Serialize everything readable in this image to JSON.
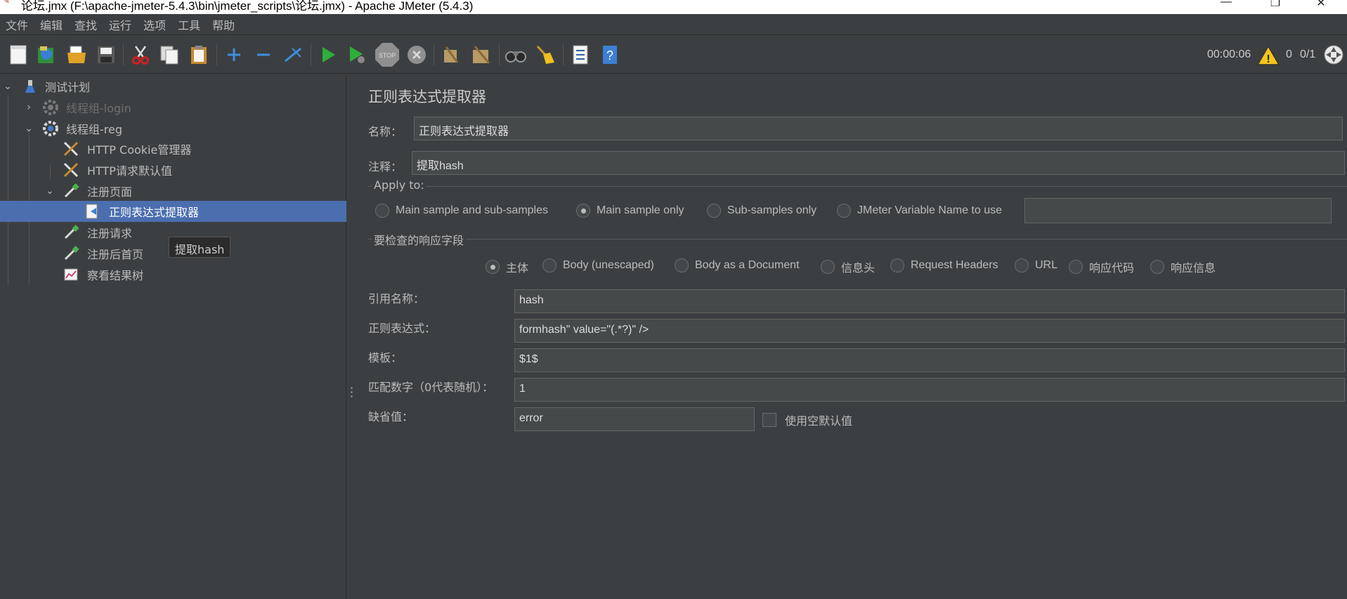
{
  "window": {
    "title": "论坛.jmx (F:\\apache-jmeter-5.4.3\\bin\\jmeter_scripts\\论坛.jmx) - Apache JMeter (5.4.3)",
    "minimize": "—",
    "maximize": "❐",
    "close": "✕"
  },
  "menu": [
    "文件",
    "编辑",
    "查找",
    "运行",
    "选项",
    "工具",
    "帮助"
  ],
  "toolbar": {
    "timer": "00:00:06",
    "warning_count": "0",
    "thread_ratio": "0/1",
    "stop_label": "STOP"
  },
  "tree": {
    "items": [
      {
        "label": "测试计划",
        "icon": "flask-icon"
      },
      {
        "label": "线程组-login",
        "icon": "gear-icon",
        "disabled": true
      },
      {
        "label": "线程组-reg",
        "icon": "gear-icon"
      },
      {
        "label": "HTTP Cookie管理器",
        "icon": "wrench-icon"
      },
      {
        "label": "HTTP请求默认值",
        "icon": "wrench-icon"
      },
      {
        "label": "注册页面",
        "icon": "pipette-icon"
      },
      {
        "label": "正则表达式提取器",
        "icon": "extractor-icon",
        "selected": true
      },
      {
        "label": "注册请求",
        "icon": "pipette-icon"
      },
      {
        "label": "注册后首页",
        "icon": "pipette-icon"
      },
      {
        "label": "察看结果树",
        "icon": "chart-icon"
      }
    ],
    "tooltip": "提取hash"
  },
  "editor": {
    "title": "正则表达式提取器",
    "name_label": "名称：",
    "name_value": "正则表达式提取器",
    "comment_label": "注释：",
    "comment_value": "提取hash",
    "apply_to": {
      "title": "Apply to:",
      "options": [
        "Main sample and sub-samples",
        "Main sample only",
        "Sub-samples only",
        "JMeter Variable Name to use"
      ],
      "selected": "Main sample only",
      "variable_name": ""
    },
    "field_to_check": {
      "title": "要检查的响应字段",
      "options": [
        "主体",
        "Body (unescaped)",
        "Body as a Document",
        "信息头",
        "Request Headers",
        "URL",
        "响应代码",
        "响应信息"
      ],
      "selected": "主体"
    },
    "ref_name_label": "引用名称：",
    "ref_name_value": "hash",
    "regex_label": "正则表达式：",
    "regex_value": "formhash\" value=\"(.*?)\" />",
    "template_label": "模板：",
    "template_value": "$1$",
    "match_no_label": "匹配数字（0代表随机）：",
    "match_no_value": "1",
    "default_label": "缺省值：",
    "default_value": "error",
    "use_empty_default_label": "使用空默认值",
    "use_empty_default_checked": false
  }
}
